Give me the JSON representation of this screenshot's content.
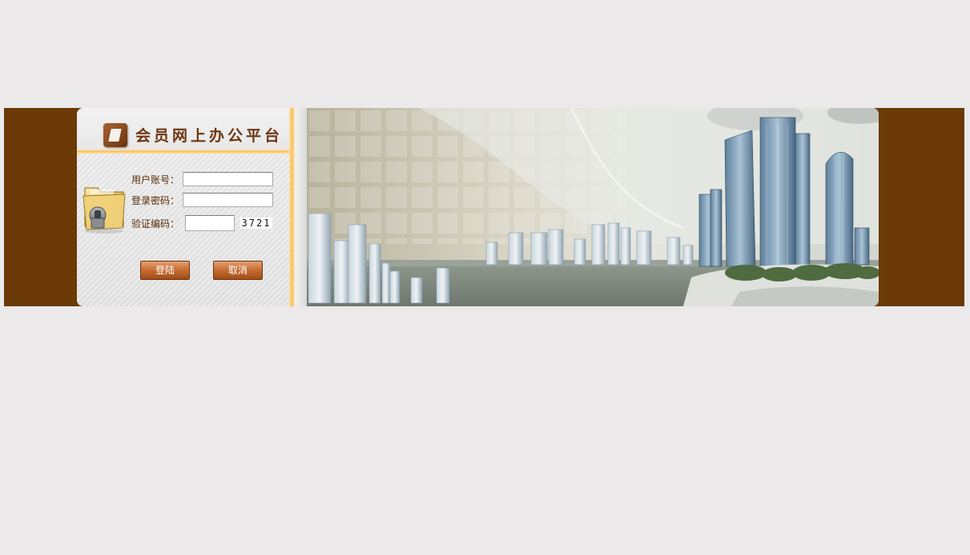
{
  "app": {
    "title": "会员网上办公平台"
  },
  "login": {
    "username_label": "用户账号：",
    "username_value": "",
    "password_label": "登录密码：",
    "password_value": "",
    "captcha_label": "验证编码：",
    "captcha_value": "",
    "captcha_code": "3721",
    "login_button": "登陆",
    "cancel_button": "取消"
  },
  "colors": {
    "page_background": "#ebe9ea",
    "band": "#6b3a06",
    "accent": "#f7be63",
    "title_text": "#6e3510",
    "button": "#c86f35"
  },
  "icons": {
    "logo": "document-icon",
    "login_illustration": "folder-lock-icon"
  }
}
